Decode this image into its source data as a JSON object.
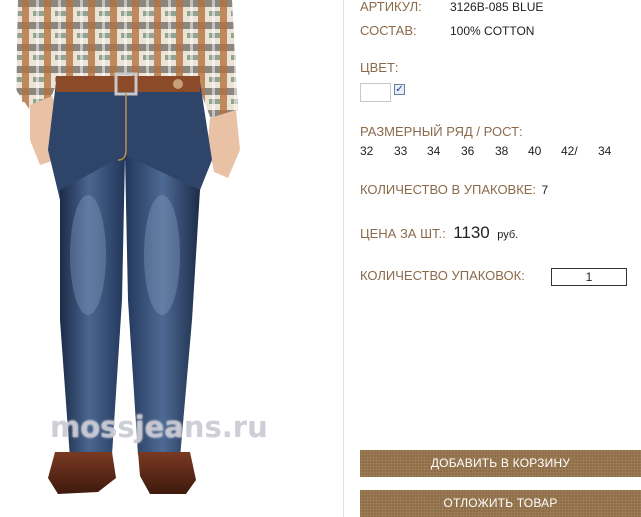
{
  "photo": {
    "watermark": "mossjeans.ru"
  },
  "product": {
    "article_label": "АРТИКУЛ:",
    "article_value": "3126B-085 BLUE",
    "composition_label": "СОСТАВ:",
    "composition_value": "100% COTTON",
    "color_label": "ЦВЕТ:",
    "color_selected": true,
    "sizes_label": "РАЗМЕРНЫЙ РЯД / РОСТ:",
    "sizes": [
      "32",
      "33",
      "34",
      "36",
      "38",
      "40",
      "42/",
      "34"
    ],
    "pack_qty_label": "КОЛИЧЕСТВО В УПАКОВКЕ:",
    "pack_qty_value": "7",
    "price_label": "ЦЕНА ЗА ШТ.:",
    "price_value": "1130",
    "price_currency": "руб.",
    "packs_label": "КОЛИЧЕСТВО УПАКОВОК:",
    "packs_value": "1"
  },
  "buttons": {
    "add_to_cart": "ДОБАВИТЬ В КОРЗИНУ",
    "postpone": "ОТЛОЖИТЬ ТОВАР"
  },
  "colors": {
    "label": "#8b6a4b",
    "button": "#8d6b43",
    "denim": "#2b3e5e",
    "shirt_check": "#b5713e"
  }
}
